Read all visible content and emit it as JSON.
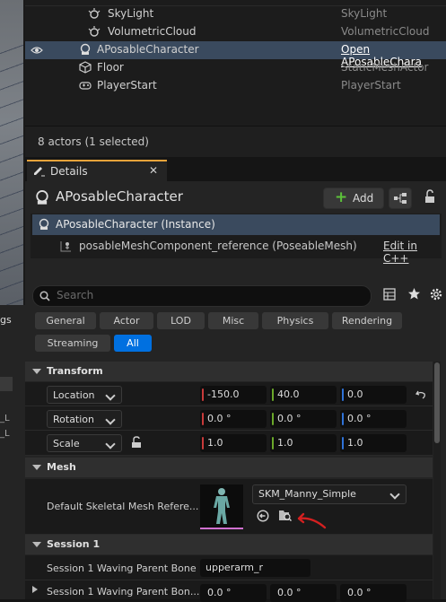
{
  "outliner": {
    "rows": [
      {
        "name": "SkyLight",
        "type": "SkyLight"
      },
      {
        "name": "VolumetricCloud",
        "type": "VolumetricCloud"
      },
      {
        "name": "APosableCharacter",
        "type": "Open APosableChara"
      },
      {
        "name": "Floor",
        "type": "StaticMeshActor"
      },
      {
        "name": "PlayerStart",
        "type": "PlayerStart"
      }
    ],
    "status": "8 actors (1 selected)"
  },
  "left_panel": {
    "tab": "gs",
    "items": [
      "_L",
      "_L"
    ]
  },
  "details": {
    "tab_label": "Details",
    "actor_name": "APosableCharacter",
    "add_label": "Add",
    "instance_label": "APosableCharacter (Instance)",
    "component_label": "posableMeshComponent_reference (PoseableMesh)",
    "edit_link": "Edit in C++",
    "search_placeholder": "Search",
    "filters": [
      "General",
      "Actor",
      "LOD",
      "Misc",
      "Physics",
      "Rendering",
      "Streaming",
      "All"
    ],
    "active_filter": "All"
  },
  "transform": {
    "section": "Transform",
    "location_label": "Location",
    "location": [
      "-150.0",
      "40.0",
      "0.0"
    ],
    "rotation_label": "Rotation",
    "rotation": [
      "0.0 °",
      "0.0 °",
      "0.0 °"
    ],
    "scale_label": "Scale",
    "scale": [
      "1.0",
      "1.0",
      "1.0"
    ]
  },
  "mesh": {
    "section": "Mesh",
    "label": "Default Skeletal Mesh Refere...",
    "value": "SKM_Manny_Simple"
  },
  "session": {
    "section": "Session 1",
    "bone_label": "Session 1 Waving Parent Bone",
    "bone_value": "upperarm_r",
    "bone2_label": "Session 1 Waving Parent Bon...",
    "bone2_values": [
      "0.0 °",
      "0.0 °",
      "0.0 °"
    ]
  }
}
